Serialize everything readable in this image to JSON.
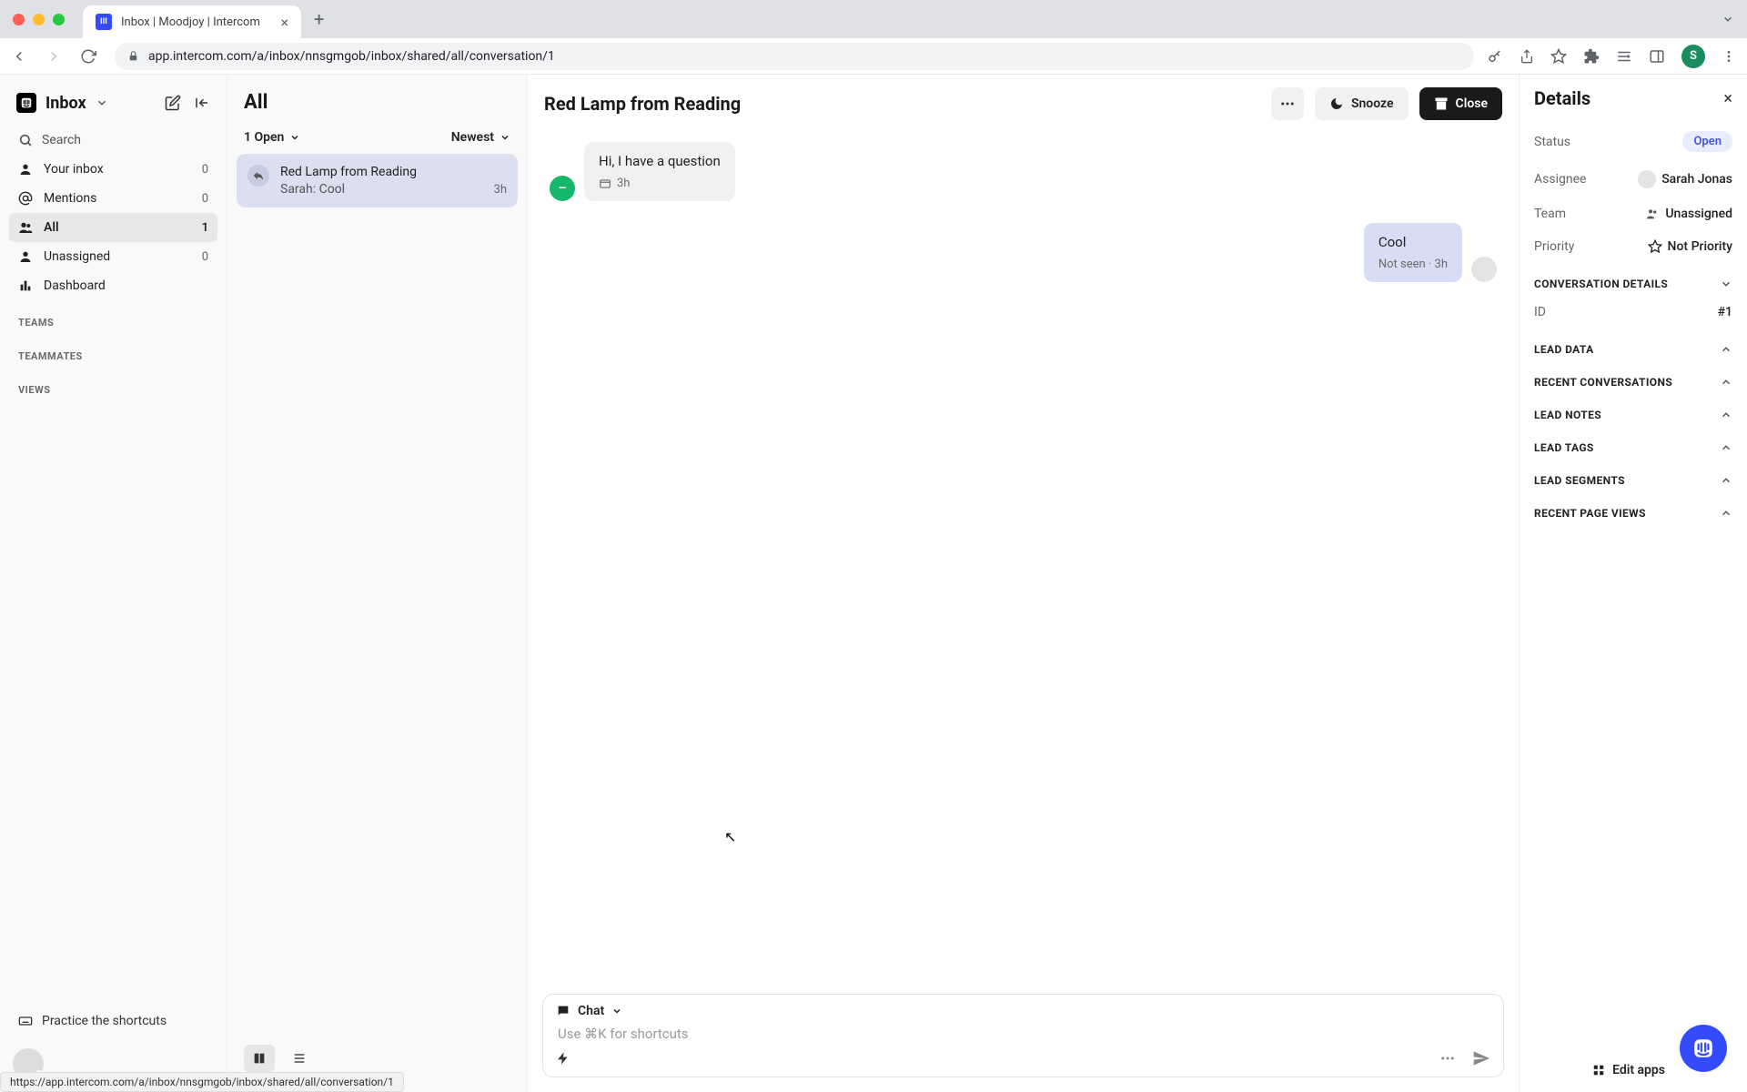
{
  "browser": {
    "tab_title": "Inbox | Moodjoy | Intercom",
    "url": "app.intercom.com/a/inbox/nnsgmgob/inbox/shared/all/conversation/1",
    "avatar_initial": "S",
    "status_url": "https://app.intercom.com/a/inbox/nnsgmgob/inbox/shared/all/conversation/1"
  },
  "sidebar": {
    "title": "Inbox",
    "search": "Search",
    "items": [
      {
        "icon": "user-icon",
        "label": "Your inbox",
        "count": "0"
      },
      {
        "icon": "at-icon",
        "label": "Mentions",
        "count": "0"
      },
      {
        "icon": "people-icon",
        "label": "All",
        "count": "1",
        "active": true
      },
      {
        "icon": "person-icon",
        "label": "Unassigned",
        "count": "0"
      },
      {
        "icon": "chart-icon",
        "label": "Dashboard",
        "count": ""
      }
    ],
    "sections": [
      "TEAMS",
      "TEAMMATES",
      "VIEWS"
    ],
    "shortcut": "Practice the shortcuts"
  },
  "list": {
    "title": "All",
    "filter_status": "1 Open",
    "sort": "Newest",
    "conversation": {
      "name": "Red Lamp from Reading",
      "snippet": "Sarah: Cool",
      "time": "3h"
    }
  },
  "conv": {
    "title": "Red Lamp from Reading",
    "snooze": "Snooze",
    "close": "Close",
    "msg_in": {
      "text": "Hi, I have a question",
      "time": "3h"
    },
    "msg_out": {
      "text": "Cool",
      "meta": "Not seen  ·  3h"
    },
    "composer": {
      "mode": "Chat",
      "placeholder": "Use ⌘K for shortcuts"
    }
  },
  "details": {
    "title": "Details",
    "rows": {
      "status_label": "Status",
      "status_value": "Open",
      "assignee_label": "Assignee",
      "assignee_value": "Sarah Jonas",
      "team_label": "Team",
      "team_value": "Unassigned",
      "priority_label": "Priority",
      "priority_value": "Not Priority"
    },
    "sections": {
      "conv_details": "CONVERSATION DETAILS",
      "id_label": "ID",
      "id_value": "#1",
      "lead_data": "LEAD DATA",
      "recent_conv": "RECENT CONVERSATIONS",
      "lead_notes": "LEAD NOTES",
      "lead_tags": "LEAD TAGS",
      "lead_segments": "LEAD SEGMENTS",
      "recent_pages": "RECENT PAGE VIEWS"
    },
    "edit_apps": "Edit apps"
  }
}
